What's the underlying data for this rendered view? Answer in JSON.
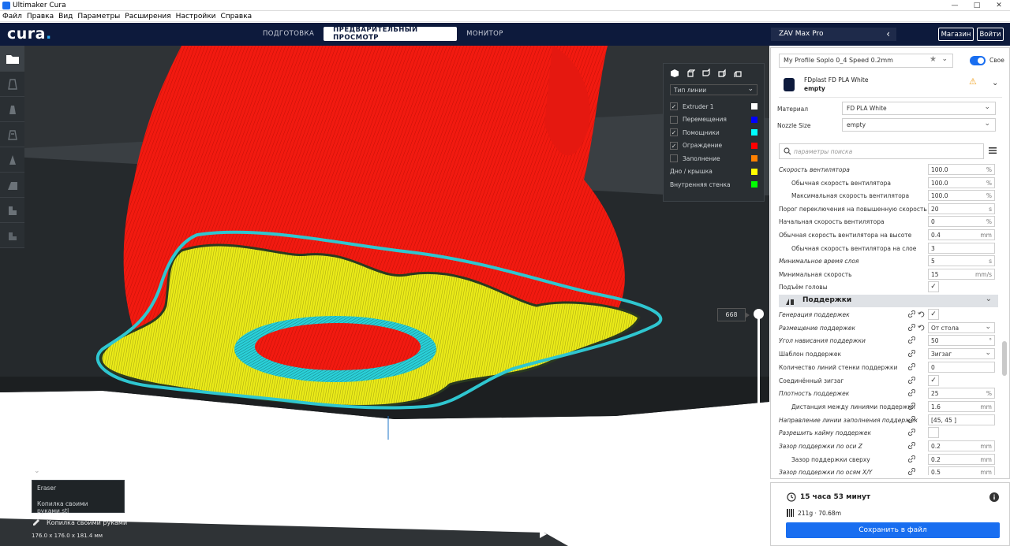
{
  "window": {
    "title": "Ultimaker Cura"
  },
  "menu": [
    "Файл",
    "Правка",
    "Вид",
    "Параметры",
    "Расширения",
    "Настройки",
    "Справка"
  ],
  "header": {
    "logo": "cura",
    "logo_dot": ".",
    "tabs": [
      {
        "label": "ПОДГОТОВКА",
        "active": false
      },
      {
        "label": "ПРЕДВАРИТЕЛЬНЫЙ ПРОСМОТР",
        "active": true
      },
      {
        "label": "МОНИТОР",
        "active": false
      }
    ],
    "printer": "ZAV Max Pro",
    "marketplace": "Магазин",
    "signin": "Войти"
  },
  "legend": {
    "line_type": "Тип линии",
    "items": [
      {
        "label": "Extruder 1",
        "checked": true,
        "color": "#ffffff"
      },
      {
        "label": "Перемещения",
        "checked": false,
        "color": "#0000ff"
      },
      {
        "label": "Помощники",
        "checked": true,
        "color": "#00ffff"
      },
      {
        "label": "Ограждение",
        "checked": true,
        "color": "#ff0000"
      },
      {
        "label": "Заполнение",
        "checked": false,
        "color": "#ff8000"
      },
      {
        "label": "Дно / крышка",
        "checked": null,
        "color": "#ffff00"
      },
      {
        "label": "Внутренняя стенка",
        "checked": null,
        "color": "#00ff00"
      }
    ]
  },
  "layer": {
    "current": "668"
  },
  "objects": {
    "list": [
      "Eraser",
      "Копилка своими руками.stl"
    ],
    "selected_name": "Копилка своими руками",
    "dimensions": "176.0 x 176.0 x 181.4 мм"
  },
  "settings_panel": {
    "profile": "My Profile Soplo 0_4 Speed   0.2mm",
    "custom_label": "Своe",
    "extruder": {
      "material": "FDplast FD PLA White",
      "nozzle": "empty"
    },
    "material_label": "Материал",
    "material_value": "FD PLA White",
    "nozzle_label": "Nozzle Size",
    "nozzle_value": "empty",
    "search_placeholder": "параметры поиска",
    "rows": [
      {
        "label": "Скорость вентилятора",
        "indent": 0,
        "italic": true,
        "value": "100.0",
        "unit": "%"
      },
      {
        "label": "Обычная скорость вентилятора",
        "indent": 1,
        "italic": false,
        "value": "100.0",
        "unit": "%"
      },
      {
        "label": "Максимальная скорость вентилятора",
        "indent": 1,
        "italic": false,
        "value": "100.0",
        "unit": "%"
      },
      {
        "label": "Порог переключения на повышенную скорость",
        "indent": 0,
        "italic": false,
        "value": "20",
        "unit": "s"
      },
      {
        "label": "Начальная скорость вентилятора",
        "indent": 0,
        "italic": false,
        "value": "0",
        "unit": "%"
      },
      {
        "label": "Обычная скорость вентилятора на высоте",
        "indent": 0,
        "italic": false,
        "value": "0.4",
        "unit": "mm"
      },
      {
        "label": "Обычная скорость вентилятора на слое",
        "indent": 1,
        "italic": false,
        "value": "3",
        "unit": ""
      },
      {
        "label": "Минимальное время слоя",
        "indent": 0,
        "italic": true,
        "value": "5",
        "unit": "s"
      },
      {
        "label": "Минимальная скорость",
        "indent": 0,
        "italic": false,
        "value": "15",
        "unit": "mm/s"
      },
      {
        "label": "Подъём головы",
        "indent": 0,
        "italic": false,
        "check": true
      }
    ],
    "section": "Поддержки",
    "support_rows": [
      {
        "label": "Генерация поддержек",
        "italic": true,
        "check": true,
        "link": true,
        "reset": true
      },
      {
        "label": "Размещение поддержек",
        "italic": true,
        "value": "От стола",
        "dropdown": true,
        "link": true,
        "reset": true
      },
      {
        "label": "Угол нависания поддержки",
        "italic": true,
        "value": "50",
        "unit": "°",
        "link": true
      },
      {
        "label": "Шаблон поддержек",
        "italic": false,
        "value": "Зигзаг",
        "dropdown": true,
        "link": true
      },
      {
        "label": "Количество линий стенки поддержки",
        "italic": false,
        "value": "0",
        "link": true
      },
      {
        "label": "Соединённый зигзаг",
        "italic": false,
        "check": true,
        "link": true
      },
      {
        "label": "Плотность поддержек",
        "italic": true,
        "value": "25",
        "unit": "%",
        "link": true
      },
      {
        "label": "Дистанция между линиями поддержки",
        "italic": false,
        "indent": 1,
        "value": "1.6",
        "unit": "mm",
        "link": true
      },
      {
        "label": "Направление линии заполнения поддержек",
        "italic": true,
        "value": "[45, 45 ]",
        "link": true
      },
      {
        "label": "Разрешить кайму поддержек",
        "italic": true,
        "check": false,
        "link": true
      },
      {
        "label": "Зазор поддержки по оси Z",
        "italic": true,
        "value": "0.2",
        "unit": "mm",
        "link": true
      },
      {
        "label": "Зазор поддержки сверху",
        "italic": false,
        "indent": 1,
        "value": "0.2",
        "unit": "mm",
        "link": true
      },
      {
        "label": "Зазор поддержки по осям X/Y",
        "italic": true,
        "value": "0.5",
        "unit": "mm",
        "link": true
      }
    ]
  },
  "print_info": {
    "time": "15 часа 53 минут",
    "material": "211g · 70.68m",
    "save": "Сохранить в файл"
  }
}
